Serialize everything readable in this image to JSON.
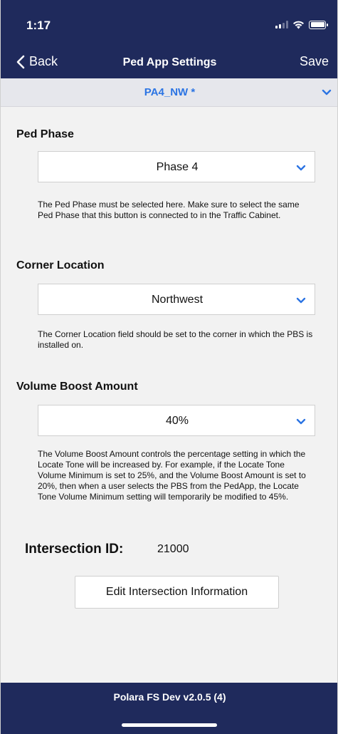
{
  "status_bar": {
    "time": "1:17"
  },
  "nav": {
    "back_label": "Back",
    "title": "Ped App Settings",
    "save_label": "Save"
  },
  "device": {
    "name": "PA4_NW *"
  },
  "ped_phase": {
    "title": "Ped Phase",
    "value": "Phase 4",
    "help": "The Ped Phase must be selected here. Make sure to select the same Ped Phase that this button is connected to in the Traffic Cabinet."
  },
  "corner_location": {
    "title": "Corner Location",
    "value": "Northwest",
    "help": "The Corner Location field should be set to the corner in which the PBS is installed on."
  },
  "volume_boost": {
    "title": "Volume Boost Amount",
    "value": "40%",
    "help": "The Volume Boost Amount controls the percentage setting in which the Locate Tone will be increased by.  For example, if the Locate Tone Volume Minimum is set to 25%, and the Volume Boost Amount is set to 20%, then when a user selects the PBS from the PedApp, the Locate Tone Volume Minimum setting will temporarily be modified to 45%."
  },
  "intersection": {
    "label": "Intersection ID:",
    "value": "21000",
    "edit_button": "Edit Intersection Information"
  },
  "footer": {
    "text": "Polara FS Dev v2.0.5 (4)"
  },
  "icons": {
    "back": "chevron-left-icon",
    "dropdown": "chevron-down-icon",
    "signal": "cellular-signal-icon",
    "wifi": "wifi-icon",
    "battery": "battery-icon"
  },
  "colors": {
    "header_bg": "#1f2a5c",
    "accent": "#2b74e3",
    "page_bg": "#f2f2f2"
  }
}
